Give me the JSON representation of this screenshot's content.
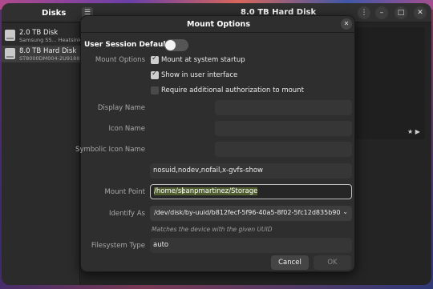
{
  "app": {
    "sidebar_title": "Disks",
    "window_title": "8.0 TB Hard Disk",
    "drives": [
      {
        "name": "2.0 TB Disk",
        "sub": "Samsung SS... Heatsink"
      },
      {
        "name": "8.0 TB Hard Disk",
        "sub": "ST8000DM004-2U9188"
      }
    ],
    "rating": "★ ▶",
    "icons": {
      "menu": "☰",
      "more": "⋮",
      "minimize": "–",
      "maximize": "□",
      "close": "✕"
    }
  },
  "dialog": {
    "title": "Mount Options",
    "close_glyph": "✕",
    "user_session_defaults_label": "User Session Defaults",
    "user_session_defaults_on": false,
    "mount_options_label": "Mount Options",
    "options": [
      {
        "label": "Mount at system startup",
        "checked": true
      },
      {
        "label": "Show in user interface",
        "checked": true
      },
      {
        "label": "Require additional authorization to mount",
        "checked": false
      }
    ],
    "display_name_label": "Display Name",
    "display_name_value": "",
    "icon_name_label": "Icon Name",
    "icon_name_value": "",
    "symbolic_icon_name_label": "Symbolic Icon Name",
    "symbolic_icon_name_value": "",
    "mount_flags_value": "nosuid,nodev,nofail,x-gvfs-show",
    "mount_point_label": "Mount Point",
    "mount_point_value": "/home/seanpmartinez/Storage",
    "identify_as_label": "Identify As",
    "identify_as_value": "/dev/disk/by-uuid/b812fecf-5f96-40a5-8f02-5fc12d835b90",
    "identify_as_hint": "Matches the device with the given UUID",
    "filesystem_type_label": "Filesystem Type",
    "filesystem_type_value": "auto",
    "cancel_label": "Cancel",
    "ok_label": "OK"
  }
}
